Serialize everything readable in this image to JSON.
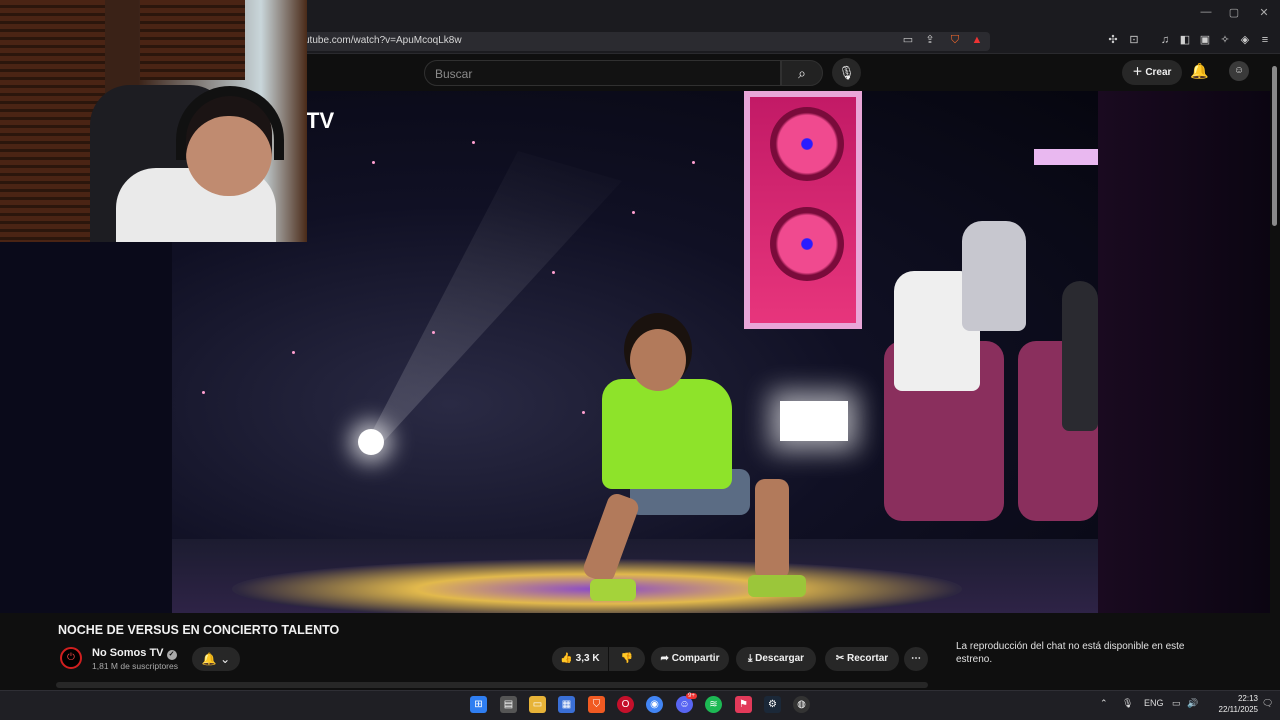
{
  "browser": {
    "url": "utube.com/watch?v=ApuMcoqLk8w",
    "window_controls": [
      "—",
      "▢",
      "✕"
    ]
  },
  "youtube_header": {
    "search_placeholder": "Buscar",
    "create_label": "Crear"
  },
  "video_overlay": {
    "logo_text": "TV"
  },
  "video_info": {
    "title": "NOCHE DE VERSUS EN CONCIERTO TALENTO",
    "channel_name": "No Somos TV",
    "subscribers": "1,81 M de suscriptores",
    "likes": "3,3 K",
    "share_label": "Compartir",
    "download_label": "Descargar",
    "clip_label": "Recortar"
  },
  "chat": {
    "message": "La reproducción del chat no está disponible en este estreno."
  },
  "taskbar": {
    "lang": "ENG",
    "time": "22:13",
    "date": "22/11/2025",
    "discord_badge": "9+"
  },
  "colors": {
    "accent_red": "#ff0000",
    "background": "#0f0f0f",
    "button_bg": "#272727"
  }
}
